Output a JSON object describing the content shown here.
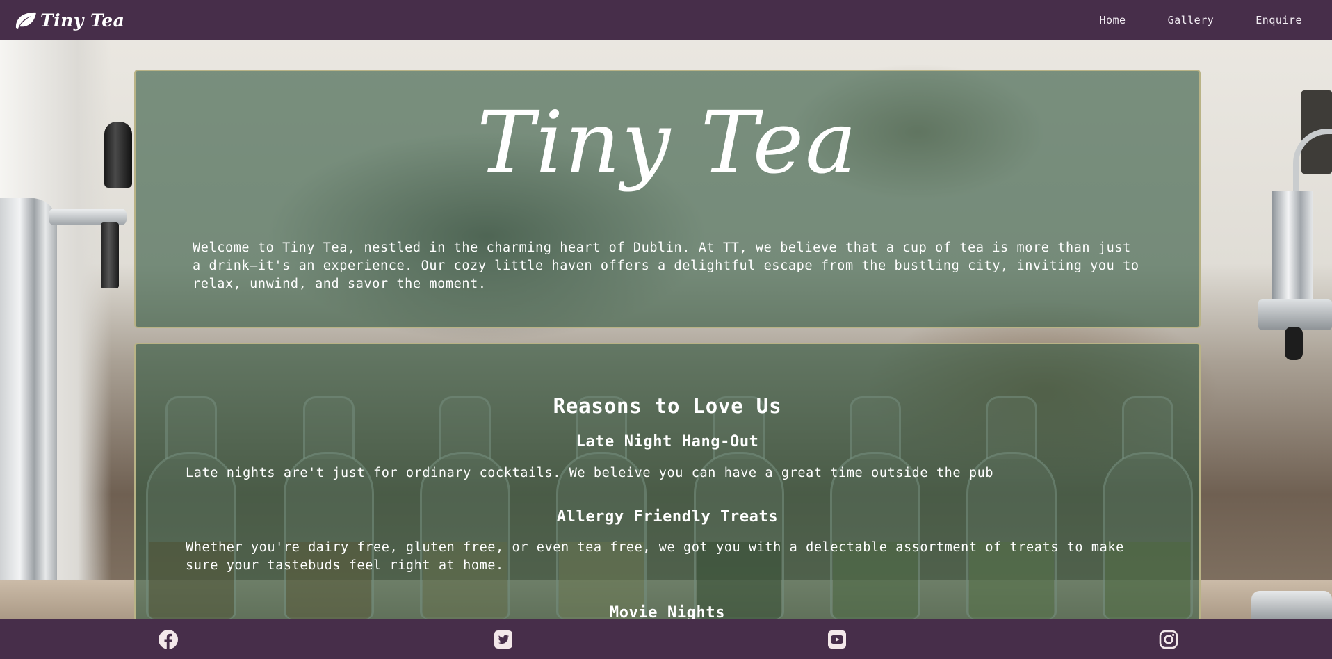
{
  "brand": {
    "name": "Tiny Tea",
    "icon": "leaf-icon"
  },
  "nav": {
    "links": [
      {
        "label": "Home"
      },
      {
        "label": "Gallery"
      },
      {
        "label": "Enquire"
      }
    ]
  },
  "hero": {
    "title": "Tiny Tea",
    "intro": "Welcome to Tiny Tea, nestled in the charming heart of Dublin. At TT, we believe that a cup of tea is more than just a drink—it's an experience. Our cozy little haven offers a delightful escape from the bustling city, inviting you to relax, unwind, and savor the moment."
  },
  "reasons": {
    "title": "Reasons to Love Us",
    "items": [
      {
        "heading": "Late Night Hang-Out",
        "text": "Late nights are't just for ordinary cocktails. We beleive you can have a great time outside the pub"
      },
      {
        "heading": "Allergy Friendly Treats",
        "text": "Whether you're dairy free, gluten free, or even tea free, we got you with a delectable assortment of treats to make sure your tastebuds feel right at home."
      },
      {
        "heading": "Movie Nights",
        "text": ""
      }
    ]
  },
  "footer": {
    "social": [
      {
        "icon": "facebook-icon"
      },
      {
        "icon": "twitter-icon"
      },
      {
        "icon": "youtube-icon"
      },
      {
        "icon": "instagram-icon"
      }
    ]
  },
  "colors": {
    "navbar": "#472e4a",
    "panel": "#345840",
    "panel_border": "#b9b386",
    "text": "#ffffff"
  }
}
